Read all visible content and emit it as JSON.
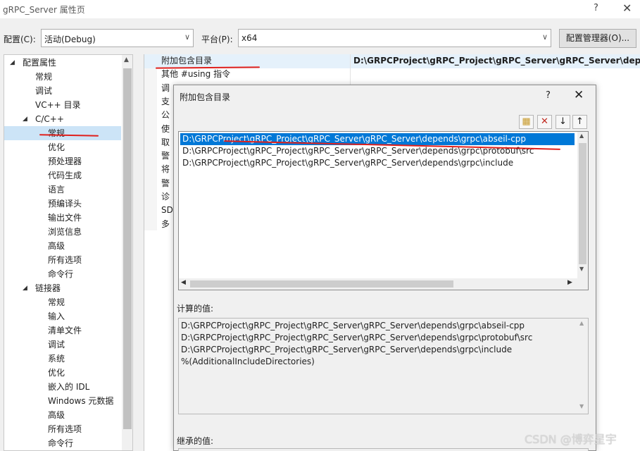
{
  "window": {
    "title": "gRPC_Server 属性页",
    "help_glyph": "?",
    "close_glyph": "✕"
  },
  "toolbar": {
    "config_label": "配置(C):",
    "config_value": "活动(Debug)",
    "platform_label": "平台(P):",
    "platform_value": "x64",
    "config_manager_label": "配置管理器(O)..."
  },
  "tree": {
    "items": [
      {
        "label": "配置属性",
        "level": 0,
        "expander": "◢"
      },
      {
        "label": "常规",
        "level": 1
      },
      {
        "label": "调试",
        "level": 1
      },
      {
        "label": "VC++ 目录",
        "level": 1
      },
      {
        "label": "C/C++",
        "level": 1,
        "expander": "◢"
      },
      {
        "label": "常规",
        "level": 2,
        "selected": true
      },
      {
        "label": "优化",
        "level": 2
      },
      {
        "label": "预处理器",
        "level": 2
      },
      {
        "label": "代码生成",
        "level": 2
      },
      {
        "label": "语言",
        "level": 2
      },
      {
        "label": "预编译头",
        "level": 2
      },
      {
        "label": "输出文件",
        "level": 2
      },
      {
        "label": "浏览信息",
        "level": 2
      },
      {
        "label": "高级",
        "level": 2
      },
      {
        "label": "所有选项",
        "level": 2
      },
      {
        "label": "命令行",
        "level": 2
      },
      {
        "label": "链接器",
        "level": 1,
        "expander": "◢"
      },
      {
        "label": "常规",
        "level": 2
      },
      {
        "label": "输入",
        "level": 2
      },
      {
        "label": "清单文件",
        "level": 2
      },
      {
        "label": "调试",
        "level": 2
      },
      {
        "label": "系统",
        "level": 2
      },
      {
        "label": "优化",
        "level": 2
      },
      {
        "label": "嵌入的 IDL",
        "level": 2
      },
      {
        "label": "Windows 元数据",
        "level": 2
      },
      {
        "label": "高级",
        "level": 2
      },
      {
        "label": "所有选项",
        "level": 2
      },
      {
        "label": "命令行",
        "level": 2
      }
    ]
  },
  "properties": {
    "rows": [
      {
        "name": "附加包含目录"
      },
      {
        "name": "其他 #using 指令"
      },
      {
        "name": "调"
      },
      {
        "name": "支"
      },
      {
        "name": "公"
      },
      {
        "name": "使"
      },
      {
        "name": "取"
      },
      {
        "name": "警"
      },
      {
        "name": "将"
      },
      {
        "name": "警"
      },
      {
        "name": "诊"
      },
      {
        "name": "SD"
      },
      {
        "name": "多"
      }
    ],
    "selected_value": "D:\\GRPCProject\\gRPC_Project\\gRPC_Server\\gRPC_Server\\depends\\"
  },
  "dialog": {
    "title": "附加包含目录",
    "help_glyph": "?",
    "close_glyph": "✕",
    "tool_icons": {
      "new_folder": "▦",
      "delete": "✕",
      "move_down": "↓",
      "move_up": "↑"
    },
    "entries": [
      "D:\\GRPCProject\\gRPC_Project\\gRPC_Server\\gRPC_Server\\depends\\grpc\\abseil-cpp",
      "D:\\GRPCProject\\gRPC_Project\\gRPC_Server\\gRPC_Server\\depends\\grpc\\protobuf\\src",
      "D:\\GRPCProject\\gRPC_Project\\gRPC_Server\\gRPC_Server\\depends\\grpc\\include"
    ],
    "evaluated_label": "计算的值:",
    "evaluated_values": [
      "D:\\GRPCProject\\gRPC_Project\\gRPC_Server\\gRPC_Server\\depends\\grpc\\abseil-cpp",
      "D:\\GRPCProject\\gRPC_Project\\gRPC_Server\\gRPC_Server\\depends\\grpc\\protobuf\\src",
      "D:\\GRPCProject\\gRPC_Project\\gRPC_Server\\gRPC_Server\\depends\\grpc\\include",
      "%(AdditionalIncludeDirectories)"
    ],
    "inherited_label": "继承的值:"
  },
  "watermark": "CSDN @博弈星宇",
  "colors": {
    "accent": "#0078d7",
    "annotation_ink": "#e0201c"
  }
}
